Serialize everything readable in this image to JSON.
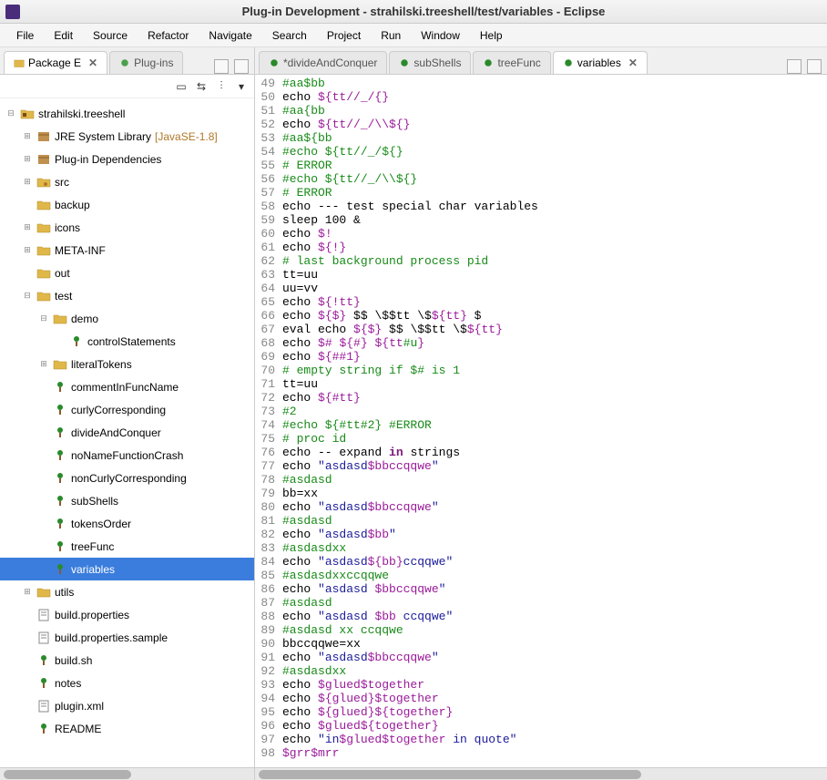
{
  "window": {
    "title": "Plug-in Development - strahilski.treeshell/test/variables - Eclipse"
  },
  "menu": {
    "file": "File",
    "edit": "Edit",
    "source": "Source",
    "refactor": "Refactor",
    "navigate": "Navigate",
    "search": "Search",
    "project": "Project",
    "run": "Run",
    "window": "Window",
    "help": "Help"
  },
  "left_tabs": {
    "pkg": "Package E",
    "plugins": "Plug-ins"
  },
  "editor_tabs": {
    "t1": "*divideAndConquer",
    "t2": "subShells",
    "t3": "treeFunc",
    "t4": "variables"
  },
  "tree": [
    {
      "d": 0,
      "tw": "-",
      "icon": "proj",
      "label": "strahilski.treeshell"
    },
    {
      "d": 1,
      "tw": "+",
      "icon": "lib",
      "label": "JRE System Library",
      "ann": "[JavaSE-1.8]"
    },
    {
      "d": 1,
      "tw": "+",
      "icon": "lib",
      "label": "Plug-in Dependencies"
    },
    {
      "d": 1,
      "tw": "+",
      "icon": "pkg",
      "label": "src"
    },
    {
      "d": 1,
      "tw": "",
      "icon": "folder",
      "label": "backup"
    },
    {
      "d": 1,
      "tw": "+",
      "icon": "folder",
      "label": "icons"
    },
    {
      "d": 1,
      "tw": "+",
      "icon": "folder",
      "label": "META-INF"
    },
    {
      "d": 1,
      "tw": "",
      "icon": "folder",
      "label": "out"
    },
    {
      "d": 1,
      "tw": "-",
      "icon": "folder",
      "label": "test"
    },
    {
      "d": 2,
      "tw": "-",
      "icon": "folder",
      "label": "demo"
    },
    {
      "d": 3,
      "tw": "",
      "icon": "tree",
      "label": "controlStatements"
    },
    {
      "d": 2,
      "tw": "+",
      "icon": "folder",
      "label": "literalTokens"
    },
    {
      "d": 2,
      "tw": "",
      "icon": "tree",
      "label": "commentInFuncName"
    },
    {
      "d": 2,
      "tw": "",
      "icon": "tree",
      "label": "curlyCorresponding"
    },
    {
      "d": 2,
      "tw": "",
      "icon": "tree",
      "label": "divideAndConquer"
    },
    {
      "d": 2,
      "tw": "",
      "icon": "tree",
      "label": "noNameFunctionCrash"
    },
    {
      "d": 2,
      "tw": "",
      "icon": "tree",
      "label": "nonCurlyCorresponding"
    },
    {
      "d": 2,
      "tw": "",
      "icon": "tree",
      "label": "subShells"
    },
    {
      "d": 2,
      "tw": "",
      "icon": "tree",
      "label": "tokensOrder"
    },
    {
      "d": 2,
      "tw": "",
      "icon": "tree",
      "label": "treeFunc"
    },
    {
      "d": 2,
      "tw": "",
      "icon": "tree",
      "label": "variables",
      "sel": true
    },
    {
      "d": 1,
      "tw": "+",
      "icon": "folder",
      "label": "utils"
    },
    {
      "d": 1,
      "tw": "",
      "icon": "file",
      "label": "build.properties"
    },
    {
      "d": 1,
      "tw": "",
      "icon": "file",
      "label": "build.properties.sample"
    },
    {
      "d": 1,
      "tw": "",
      "icon": "tree",
      "label": "build.sh"
    },
    {
      "d": 1,
      "tw": "",
      "icon": "tree",
      "label": "notes"
    },
    {
      "d": 1,
      "tw": "",
      "icon": "file",
      "label": "plugin.xml"
    },
    {
      "d": 1,
      "tw": "",
      "icon": "tree",
      "label": "README"
    }
  ],
  "code": [
    {
      "n": 49,
      "seg": [
        [
          "cm",
          "#aa$bb"
        ]
      ]
    },
    {
      "n": 50,
      "seg": [
        [
          "",
          "echo "
        ],
        [
          "var",
          "${tt//_/{}"
        ]
      ]
    },
    {
      "n": 51,
      "seg": [
        [
          "cm",
          "#aa{bb"
        ]
      ]
    },
    {
      "n": 52,
      "seg": [
        [
          "",
          "echo "
        ],
        [
          "var",
          "${tt//_/\\\\${}"
        ]
      ]
    },
    {
      "n": 53,
      "seg": [
        [
          "cm",
          "#aa${bb"
        ]
      ]
    },
    {
      "n": 54,
      "seg": [
        [
          "cm",
          "#echo ${tt//_/${}"
        ]
      ]
    },
    {
      "n": 55,
      "seg": [
        [
          "cm",
          "# ERROR"
        ]
      ]
    },
    {
      "n": 56,
      "seg": [
        [
          "cm",
          "#echo ${tt//_/\\\\${}"
        ]
      ]
    },
    {
      "n": 57,
      "seg": [
        [
          "cm",
          "# ERROR"
        ]
      ]
    },
    {
      "n": 58,
      "seg": [
        [
          "",
          "echo --- test special char variables"
        ]
      ]
    },
    {
      "n": 59,
      "seg": [
        [
          "",
          "sleep 100 &"
        ]
      ]
    },
    {
      "n": 60,
      "seg": [
        [
          "",
          "echo "
        ],
        [
          "var",
          "$!"
        ]
      ]
    },
    {
      "n": 61,
      "seg": [
        [
          "",
          "echo "
        ],
        [
          "var",
          "${!}"
        ]
      ]
    },
    {
      "n": 62,
      "seg": [
        [
          "cm",
          "# last background process pid"
        ]
      ]
    },
    {
      "n": 63,
      "seg": [
        [
          "",
          "tt=uu"
        ]
      ]
    },
    {
      "n": 64,
      "seg": [
        [
          "",
          "uu=vv"
        ]
      ]
    },
    {
      "n": 65,
      "seg": [
        [
          "",
          "echo "
        ],
        [
          "var",
          "${!tt}"
        ]
      ]
    },
    {
      "n": 66,
      "seg": [
        [
          "",
          "echo "
        ],
        [
          "var",
          "${$}"
        ],
        [
          "",
          " $$ \\$$tt \\$"
        ],
        [
          "var",
          "${tt}"
        ],
        [
          "",
          " $"
        ]
      ]
    },
    {
      "n": 67,
      "seg": [
        [
          "",
          "eval echo "
        ],
        [
          "var",
          "${$}"
        ],
        [
          "",
          " $$ \\$$tt \\$"
        ],
        [
          "var",
          "${tt}"
        ]
      ]
    },
    {
      "n": 68,
      "seg": [
        [
          "",
          "echo "
        ],
        [
          "var",
          "$#"
        ],
        [
          "",
          " "
        ],
        [
          "var",
          "${#}"
        ],
        [
          "",
          " "
        ],
        [
          "var",
          "${tt"
        ],
        [
          "cm",
          "#u"
        ],
        [
          "var",
          "}"
        ]
      ]
    },
    {
      "n": 69,
      "seg": [
        [
          "",
          "echo "
        ],
        [
          "var",
          "${##1}"
        ]
      ]
    },
    {
      "n": 70,
      "seg": [
        [
          "cm",
          "# empty string if $# is 1"
        ]
      ]
    },
    {
      "n": 71,
      "seg": [
        [
          "",
          "tt=uu"
        ]
      ]
    },
    {
      "n": 72,
      "seg": [
        [
          "",
          "echo "
        ],
        [
          "var",
          "${#tt}"
        ]
      ]
    },
    {
      "n": 73,
      "seg": [
        [
          "cm",
          "#2"
        ]
      ]
    },
    {
      "n": 74,
      "seg": [
        [
          "cm",
          "#echo ${#tt#2} #ERROR"
        ]
      ]
    },
    {
      "n": 75,
      "seg": [
        [
          "cm",
          "# proc id"
        ]
      ]
    },
    {
      "n": 76,
      "seg": [
        [
          "",
          "echo -- expand "
        ],
        [
          "kw",
          "in"
        ],
        [
          "",
          " strings"
        ]
      ]
    },
    {
      "n": 77,
      "seg": [
        [
          "",
          "echo "
        ],
        [
          "str",
          "\"asdasd"
        ],
        [
          "var",
          "$bbccqqwe"
        ],
        [
          "str",
          "\""
        ]
      ]
    },
    {
      "n": 78,
      "seg": [
        [
          "cm",
          "#asdasd"
        ]
      ]
    },
    {
      "n": 79,
      "seg": [
        [
          "",
          "bb=xx"
        ]
      ]
    },
    {
      "n": 80,
      "seg": [
        [
          "",
          "echo "
        ],
        [
          "str",
          "\"asdasd"
        ],
        [
          "var",
          "$bbccqqwe"
        ],
        [
          "str",
          "\""
        ]
      ]
    },
    {
      "n": 81,
      "seg": [
        [
          "cm",
          "#asdasd"
        ]
      ]
    },
    {
      "n": 82,
      "seg": [
        [
          "",
          "echo "
        ],
        [
          "str",
          "\"asdasd"
        ],
        [
          "var",
          "$bb"
        ],
        [
          "str",
          "\""
        ]
      ]
    },
    {
      "n": 83,
      "seg": [
        [
          "cm",
          "#asdasdxx"
        ]
      ]
    },
    {
      "n": 84,
      "seg": [
        [
          "",
          "echo "
        ],
        [
          "str",
          "\"asdasd"
        ],
        [
          "var",
          "${bb}"
        ],
        [
          "str",
          "ccqqwe\""
        ]
      ]
    },
    {
      "n": 85,
      "seg": [
        [
          "cm",
          "#asdasdxxccqqwe"
        ]
      ]
    },
    {
      "n": 86,
      "seg": [
        [
          "",
          "echo "
        ],
        [
          "str",
          "\"asdasd "
        ],
        [
          "var",
          "$bbccqqwe"
        ],
        [
          "str",
          "\""
        ]
      ]
    },
    {
      "n": 87,
      "seg": [
        [
          "cm",
          "#asdasd"
        ]
      ]
    },
    {
      "n": 88,
      "seg": [
        [
          "",
          "echo "
        ],
        [
          "str",
          "\"asdasd "
        ],
        [
          "var",
          "$bb"
        ],
        [
          "str",
          " ccqqwe\""
        ]
      ]
    },
    {
      "n": 89,
      "seg": [
        [
          "cm",
          "#asdasd xx ccqqwe"
        ]
      ]
    },
    {
      "n": 90,
      "seg": [
        [
          "",
          "bbccqqwe=xx"
        ]
      ]
    },
    {
      "n": 91,
      "seg": [
        [
          "",
          "echo "
        ],
        [
          "str",
          "\"asdasd"
        ],
        [
          "var",
          "$bbccqqwe"
        ],
        [
          "str",
          "\""
        ]
      ]
    },
    {
      "n": 92,
      "seg": [
        [
          "cm",
          "#asdasdxx"
        ]
      ]
    },
    {
      "n": 93,
      "seg": [
        [
          "",
          "echo "
        ],
        [
          "var",
          "$glued$together"
        ]
      ]
    },
    {
      "n": 94,
      "seg": [
        [
          "",
          "echo "
        ],
        [
          "var",
          "${glued}$together"
        ]
      ]
    },
    {
      "n": 95,
      "seg": [
        [
          "",
          "echo "
        ],
        [
          "var",
          "${glued}${together}"
        ]
      ]
    },
    {
      "n": 96,
      "seg": [
        [
          "",
          "echo "
        ],
        [
          "var",
          "$glued${together}"
        ]
      ]
    },
    {
      "n": 97,
      "seg": [
        [
          "",
          "echo "
        ],
        [
          "str",
          "\"in"
        ],
        [
          "var",
          "$glued$together"
        ],
        [
          "str",
          " in quote\""
        ]
      ]
    },
    {
      "n": 98,
      "seg": [
        [
          "var",
          "$grr$mrr"
        ]
      ]
    }
  ]
}
